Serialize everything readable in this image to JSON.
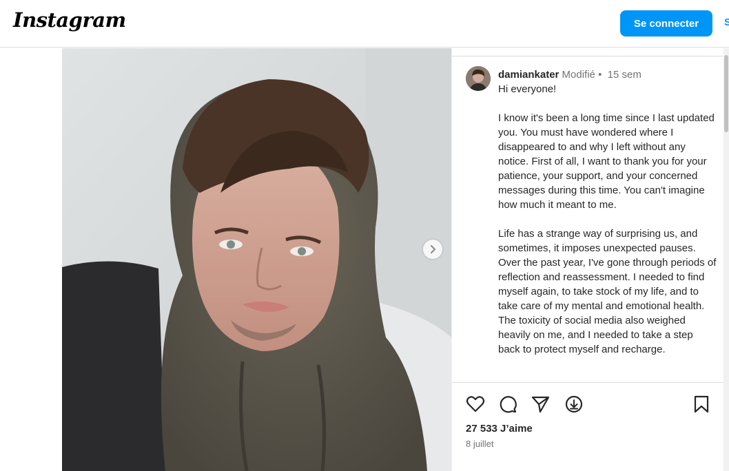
{
  "header": {
    "logo_text": "Instagram",
    "login_label": "Se connecter",
    "signup_label": "S"
  },
  "post": {
    "username": "damiankater",
    "edited": "Modifié",
    "separator": "•",
    "age": "15 sem",
    "caption_paragraphs": [
      "Hi everyone!",
      "I know it's been a long time since I last updated you. You must have wondered where I disappeared to and why I left without any notice. First of all, I want to thank you for your patience, your support, and your concerned messages during this time. You can't imagine how much it meant to me.",
      "Life has a strange way of surprising us, and sometimes, it imposes unexpected pauses. Over the past year, I've gone through periods of reflection and reassessment. I needed to find myself again, to take stock of my life, and to take care of my mental and emotional health. The toxicity of social media also weighed heavily on me, and I needed to take a step back to protect myself and recharge."
    ],
    "likes": "27 533 J’aime",
    "date": "8 juillet"
  },
  "icons": {
    "like": "heart-icon",
    "comment": "comment-icon",
    "share": "send-icon",
    "download": "download-icon",
    "save": "bookmark-icon",
    "next": "chevron-right-icon"
  },
  "colors": {
    "accent": "#0095f6",
    "text": "#262626",
    "muted": "#737373"
  }
}
